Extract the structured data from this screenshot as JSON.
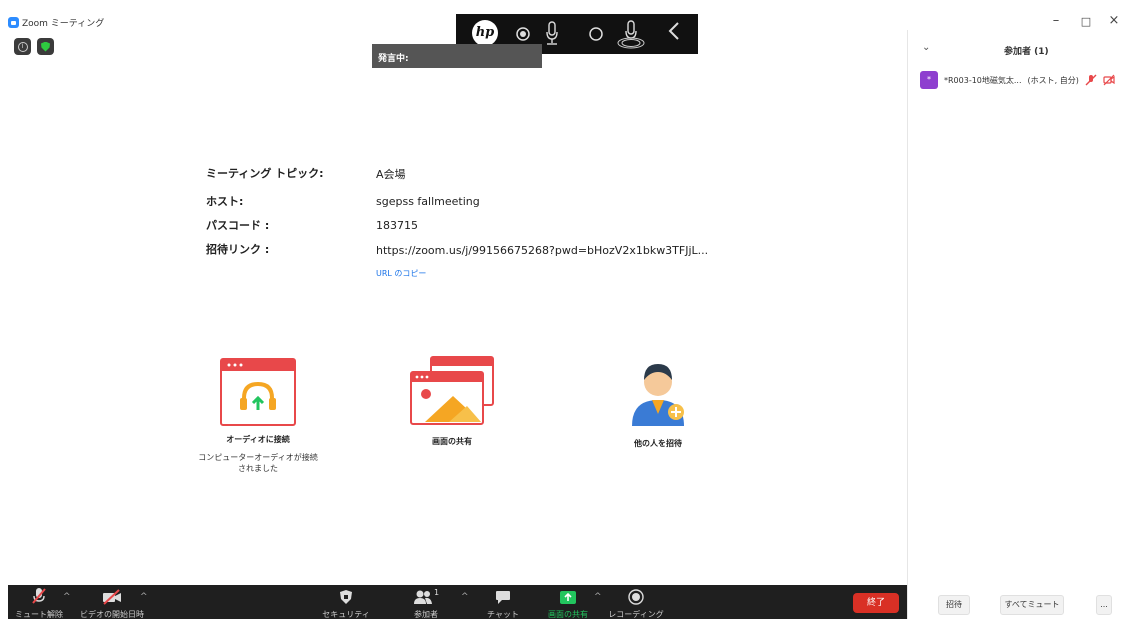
{
  "window": {
    "title": "Zoom ミーティング",
    "controls": {
      "minimize": "–",
      "maximize": "□",
      "close": "×"
    }
  },
  "hp_bar": {
    "logo": "hp"
  },
  "speaking_banner": "発言中:",
  "meeting_info": {
    "topic_label": "ミーティング トピック:",
    "topic_value": "A会場",
    "host_label": "ホスト:",
    "host_value": "sgepss fallmeeting",
    "passcode_label": "パスコード :",
    "passcode_value": "183715",
    "invite_label": "招待リンク :",
    "invite_value": "https://zoom.us/j/99156675268?pwd=bHozV2x1bkw3TFJjL...",
    "copy_url": "URL のコピー"
  },
  "actions": {
    "audio": {
      "label": "オーディオに接続",
      "sub": "コンピューターオーディオが接続されました"
    },
    "share": {
      "label": "画面の共有"
    },
    "invite": {
      "label": "他の人を招待"
    }
  },
  "toolbar": {
    "unmute": "ミュート解除",
    "start_video": "ビデオの開始日時",
    "security": "セキュリティ",
    "participants": "参加者",
    "participant_count": "1",
    "chat": "チャット",
    "share_screen": "画面の共有",
    "record": "レコーディング",
    "end": "終了"
  },
  "panel": {
    "title": "参加者 (1)",
    "participant_name": "*R003-10地磁気太...",
    "participant_role": "(ホスト, 自分)",
    "avatar_letter": "*",
    "invite_button": "招待",
    "mute_all_button": "すべてミュート",
    "more_button": "..."
  },
  "colors": {
    "toolbar_bg": "#1f1f1f",
    "end_button": "#d93025",
    "share_green": "#22c55e",
    "avatar_purple": "#8e3fcf",
    "link_blue": "#1a73e8",
    "icon_red": "#e8484a"
  }
}
